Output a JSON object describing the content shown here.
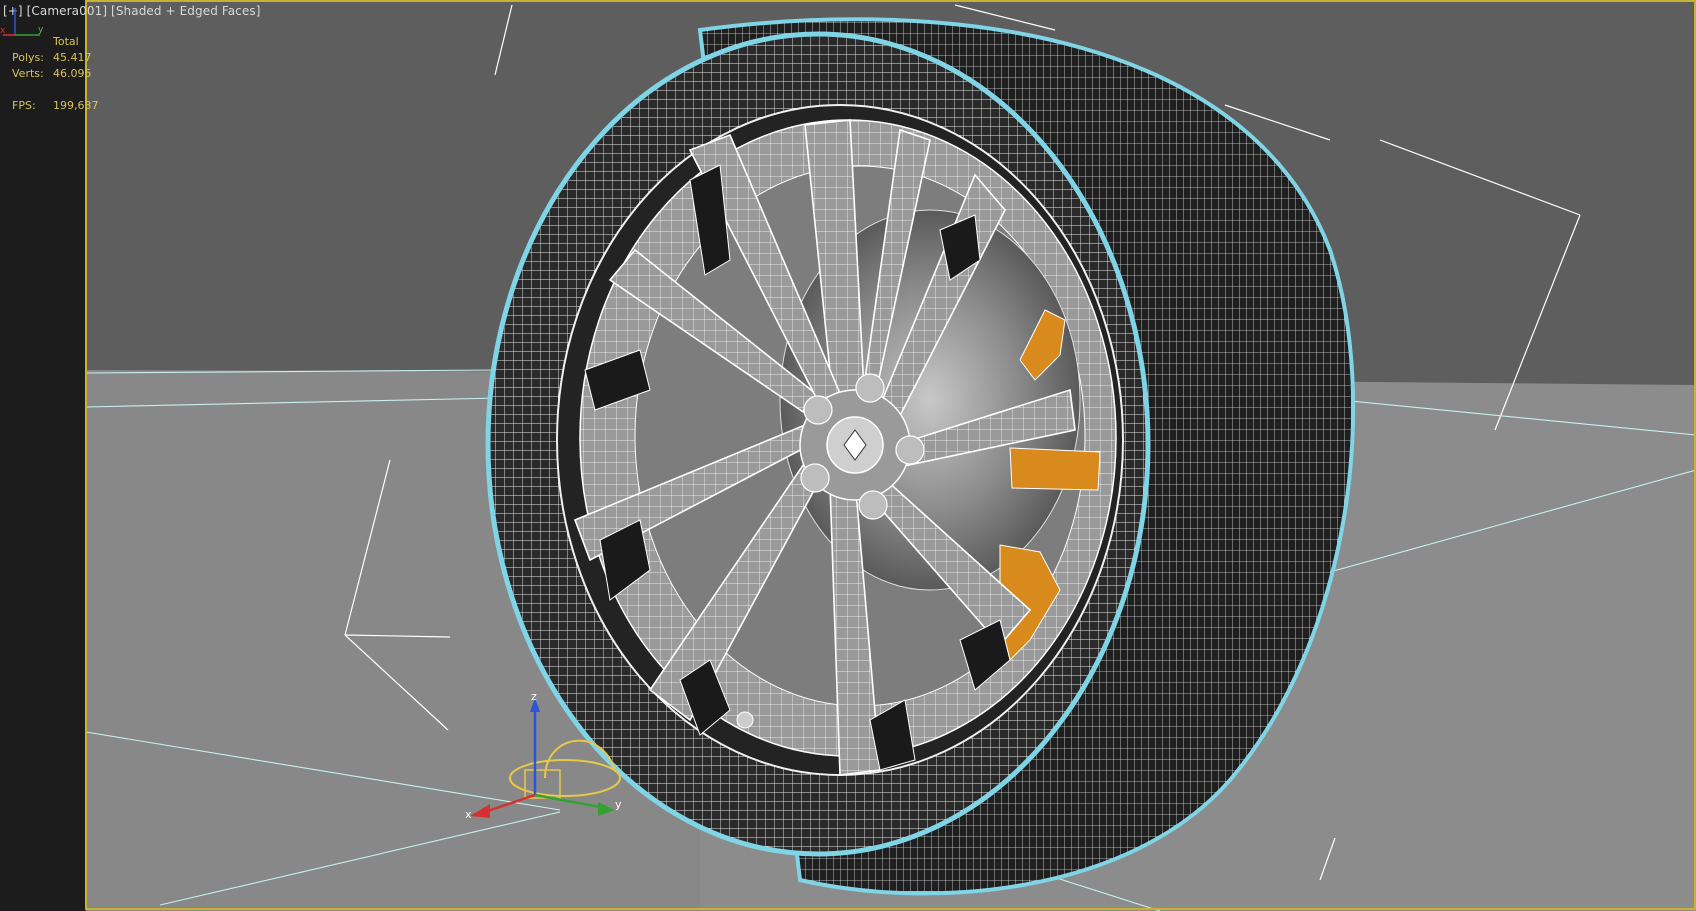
{
  "viewport": {
    "menu_label": "[+]",
    "camera_label": "[Camera001]",
    "shading_label": "[Shaded + Edged Faces]",
    "active_border_color": "#c9b22e"
  },
  "stats": {
    "header": "Total",
    "polys_label": "Polys:",
    "polys_value": "45.417",
    "verts_label": "Verts:",
    "verts_value": "46.095",
    "fps_label": "FPS:",
    "fps_value": "199,637"
  },
  "gizmo": {
    "x_label": "x",
    "y_label": "y",
    "z_label": "z"
  },
  "mini_axis": {
    "x_label": "x",
    "y_label": "y"
  },
  "colors": {
    "background_top": "#5e5e5e",
    "ground_plane": "#8c8c8c",
    "selection_outline": "#7fd4e6",
    "caliper": "#d88a1c",
    "wire": "#ffffff"
  }
}
